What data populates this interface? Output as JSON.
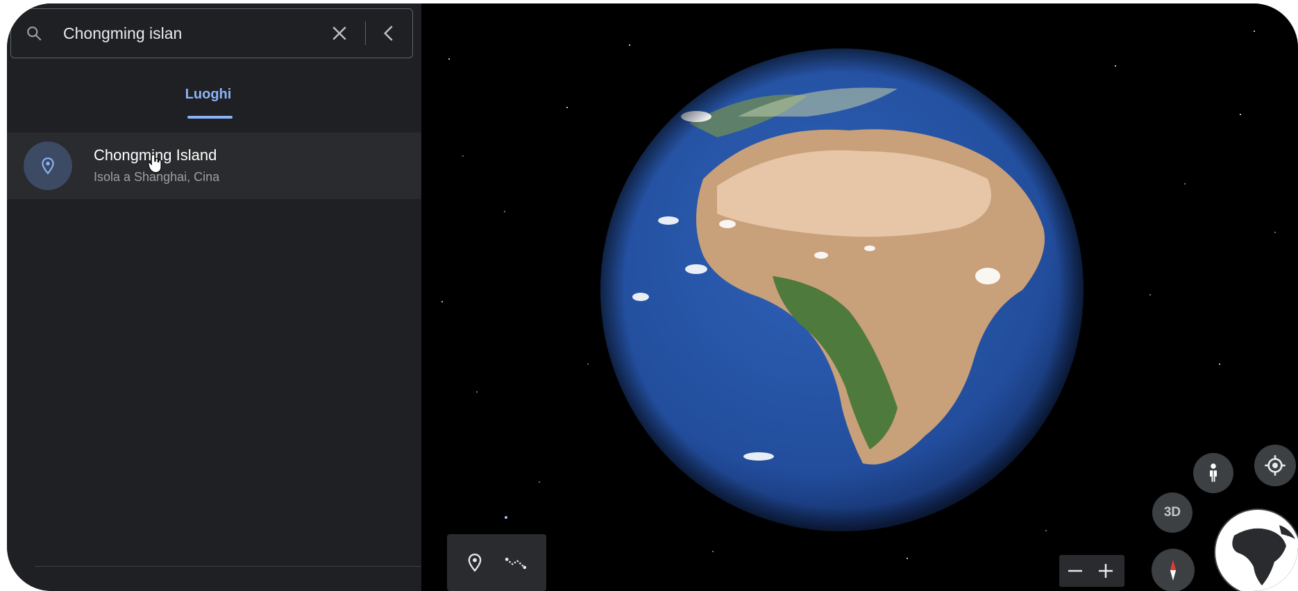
{
  "search": {
    "value": "Chongming islan",
    "icons": {
      "search": "search-icon",
      "clear": "close-icon",
      "back": "chevron-left-icon"
    }
  },
  "tabs": [
    {
      "label": "Luoghi",
      "active": true
    }
  ],
  "results": [
    {
      "title": "Chongming Island",
      "subtitle": "Isola a Shanghai, Cina",
      "icon": "place-pin-icon"
    }
  ],
  "map_controls": {
    "view_mode_label": "3D",
    "tools": [
      "place-pin-icon",
      "measure-path-icon"
    ],
    "zoom": [
      "zoom-out-icon",
      "zoom-in-icon"
    ],
    "other": [
      "street-view-pegman-icon",
      "my-location-icon",
      "compass-icon",
      "globe-minimap"
    ]
  },
  "colors": {
    "panel_bg": "#1f2023",
    "accent": "#8ab4f8",
    "result_bg": "#2a2b2e",
    "space_bg": "#000000"
  }
}
